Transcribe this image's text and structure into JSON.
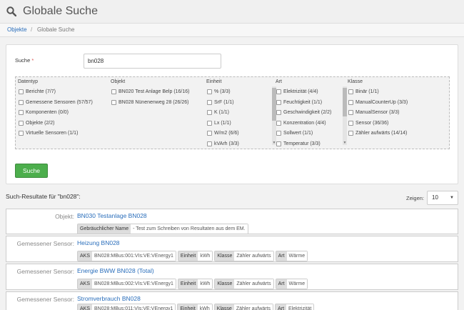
{
  "header": {
    "title": "Globale Suche"
  },
  "breadcrumb": {
    "items": [
      "Objekte",
      "Globale Suche"
    ],
    "separator": "/"
  },
  "form": {
    "search_label": "Suche",
    "required_mark": "*",
    "search_value": "bn028",
    "search_button": "Suche"
  },
  "filters": {
    "datentyp": {
      "header": "Datentyp",
      "options": [
        "Berichte (7/7)",
        "Gemessene Sensoren (57/57)",
        "Komponenten (0/0)",
        "Objekte (2/2)",
        "Virtuelle Sensoren (1/1)"
      ]
    },
    "objekt": {
      "header": "Objekt",
      "options": [
        "BN020 Test Anlage Belp (16/16)",
        "BN028 Nünenenweg 28 (26/26)"
      ]
    },
    "einheit": {
      "header": "Einheit",
      "options": [
        "% (3/3)",
        "SrF (1/1)",
        "K (1/1)",
        "Lx (1/1)",
        "W/m2 (6/6)",
        "kVArh (3/3)"
      ]
    },
    "art": {
      "header": "Art",
      "options": [
        "Elektrizität (4/4)",
        "Feuchtigkeit (1/1)",
        "Geschwindigkeit (2/2)",
        "Konzentration (4/4)",
        "Sollwert (1/1)",
        "Temperatur (3/3)"
      ]
    },
    "klasse": {
      "header": "Klasse",
      "options": [
        "Binär (1/1)",
        "ManualCounterUp (3/3)",
        "ManualSensor (3/3)",
        "Sensor (36/36)",
        "Zähler aufwärts (14/14)"
      ]
    }
  },
  "results": {
    "title": "Such-Resultate für \"bn028\":",
    "show_label": "Zeigen:",
    "show_value": "10",
    "items": [
      {
        "type_label": "Objekt:",
        "name": "BN030 Testanlage BN028",
        "tags": [
          {
            "k": "Gebräuchlicher Name",
            "v": "- Test zum Schreiben von Resultaten aus dem EM."
          }
        ]
      },
      {
        "type_label": "Gemessener Sensor:",
        "name": "Heizung BN028",
        "tags": [
          {
            "k": "AKS",
            "v": "BN028:MBus:001:VIs:VE:VEnergy1"
          },
          {
            "k": "Einheit",
            "v": "kWh"
          },
          {
            "k": "Klasse",
            "v": "Zähler aufwärts"
          },
          {
            "k": "Art",
            "v": "Wärme"
          }
        ]
      },
      {
        "type_label": "Gemessener Sensor:",
        "name": "Energie BWW BN028 (Total)",
        "tags": [
          {
            "k": "AKS",
            "v": "BN028:MBus:002:VIs:VE:VEnergy1"
          },
          {
            "k": "Einheit",
            "v": "kWh"
          },
          {
            "k": "Klasse",
            "v": "Zähler aufwärts"
          },
          {
            "k": "Art",
            "v": "Wärme"
          }
        ]
      },
      {
        "type_label": "Gemessener Sensor:",
        "name": "Stromverbrauch BN028",
        "tags": [
          {
            "k": "AKS",
            "v": "BN028:MBus:011:VIs:VE:VEnergy1"
          },
          {
            "k": "Einheit",
            "v": "kWh"
          },
          {
            "k": "Klasse",
            "v": "Zähler aufwärts"
          },
          {
            "k": "Art",
            "v": "Elektrizität"
          }
        ]
      }
    ]
  },
  "colors": {
    "accent": "#2a6ebb",
    "button": "#4cae4c",
    "required": "#d9534f"
  }
}
